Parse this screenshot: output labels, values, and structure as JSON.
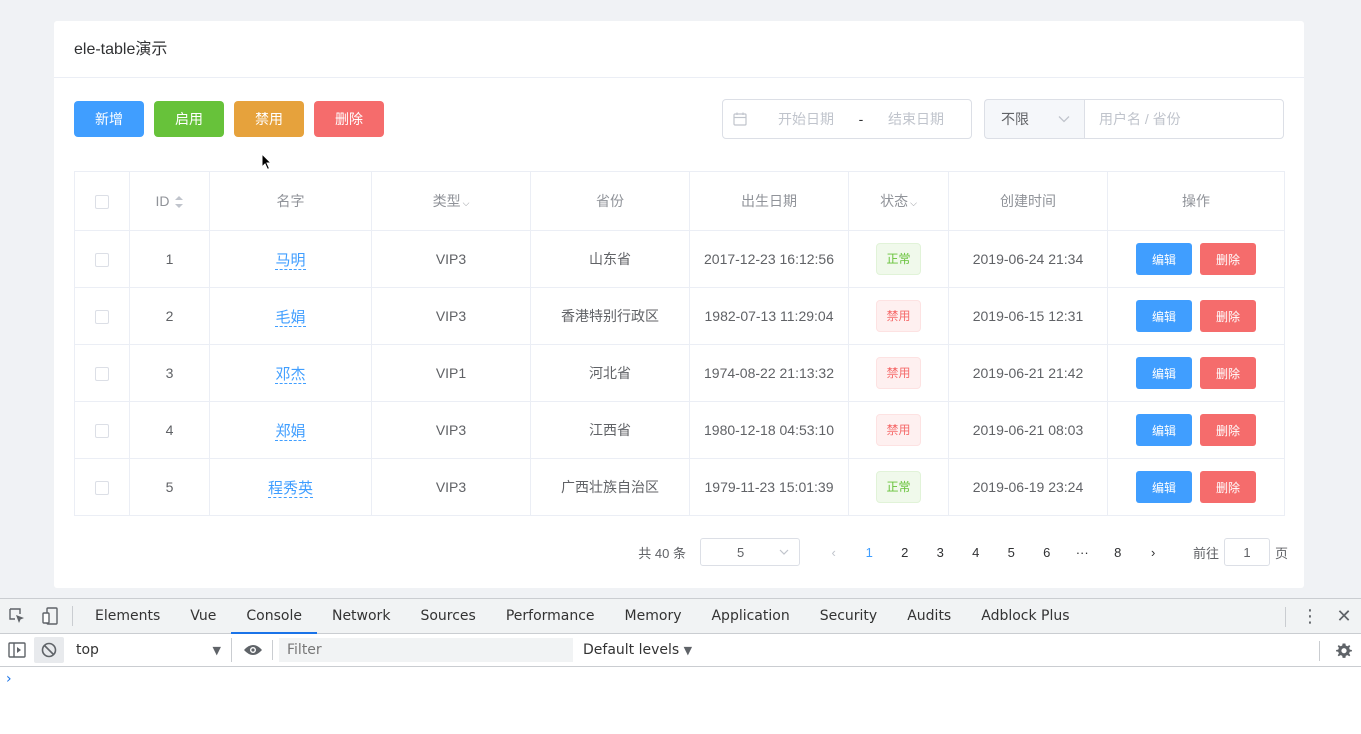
{
  "card": {
    "title": "ele-table演示"
  },
  "toolbar": {
    "add": "新增",
    "enable": "启用",
    "disable": "禁用",
    "delete": "删除"
  },
  "filters": {
    "start_placeholder": "开始日期",
    "range_separator": "-",
    "end_placeholder": "结束日期",
    "type_select": "不限",
    "search_placeholder": "用户名 / 省份"
  },
  "table": {
    "columns": [
      "ID",
      "名字",
      "类型",
      "省份",
      "出生日期",
      "状态",
      "创建时间",
      "操作"
    ],
    "edit_label": "编辑",
    "delete_label": "删除",
    "rows": [
      {
        "id": "1",
        "name": "马明",
        "type": "VIP3",
        "province": "山东省",
        "birth": "2017-12-23 16:12:56",
        "status": "正常",
        "status_kind": "ok",
        "created": "2019-06-24 21:34"
      },
      {
        "id": "2",
        "name": "毛娟",
        "type": "VIP3",
        "province": "香港特别行政区",
        "birth": "1982-07-13 11:29:04",
        "status": "禁用",
        "status_kind": "off",
        "created": "2019-06-15 12:31"
      },
      {
        "id": "3",
        "name": "邓杰",
        "type": "VIP1",
        "province": "河北省",
        "birth": "1974-08-22 21:13:32",
        "status": "禁用",
        "status_kind": "off",
        "created": "2019-06-21 21:42"
      },
      {
        "id": "4",
        "name": "郑娟",
        "type": "VIP3",
        "province": "江西省",
        "birth": "1980-12-18 04:53:10",
        "status": "禁用",
        "status_kind": "off",
        "created": "2019-06-21 08:03"
      },
      {
        "id": "5",
        "name": "程秀英",
        "type": "VIP3",
        "province": "广西壮族自治区",
        "birth": "1979-11-23 15:01:39",
        "status": "正常",
        "status_kind": "ok",
        "created": "2019-06-19 23:24"
      }
    ]
  },
  "pagination": {
    "total": "共 40 条",
    "page_size": "5",
    "pages": [
      "1",
      "2",
      "3",
      "4",
      "5",
      "6",
      "···",
      "8"
    ],
    "current": "1",
    "goto_prefix": "前往",
    "goto_value": "1",
    "goto_suffix": "页"
  },
  "devtools": {
    "tabs": [
      "Elements",
      "Vue",
      "Console",
      "Network",
      "Sources",
      "Performance",
      "Memory",
      "Application",
      "Security",
      "Audits",
      "Adblock Plus"
    ],
    "active_tab": "Console",
    "context": "top",
    "filter_placeholder": "Filter",
    "levels": "Default levels",
    "prompt": "›"
  },
  "colors": {
    "primary": "#409eff",
    "success": "#67c23a",
    "warning": "#e6a23c",
    "danger": "#f56c6c",
    "devtools_accent": "#1a73e8"
  }
}
